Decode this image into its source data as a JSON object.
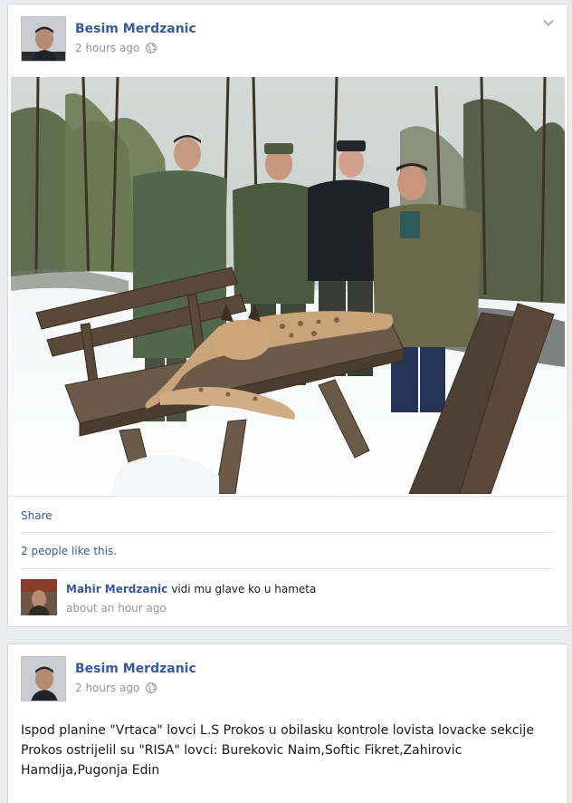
{
  "posts": [
    {
      "author": "Besim Merdzanic",
      "time": "2 hours ago",
      "share_label": "Share",
      "likes_text": "2 people like this.",
      "comment": {
        "author": "Mahir Merdzanic",
        "text": "vidi mu glave ko u hameta",
        "time": "about an hour ago"
      }
    },
    {
      "author": "Besim Merdzanic",
      "time": "2 hours ago",
      "text": "Ispod planine \"Vrtaca\" lovci L.S Prokos u obilasku kontrole lovista lovacke sekcije Prokos ostrijelil su \"RISA\" lovci: Burekovic Naim,Softic Fikret,Zahirovic Hamdija,Pugonja Edin"
    }
  ],
  "icons": {
    "privacy": "globe-icon",
    "options": "chevron-down-icon"
  },
  "colors": {
    "link": "#3b5998",
    "meta": "#90949c",
    "background": "#e9ebee"
  }
}
